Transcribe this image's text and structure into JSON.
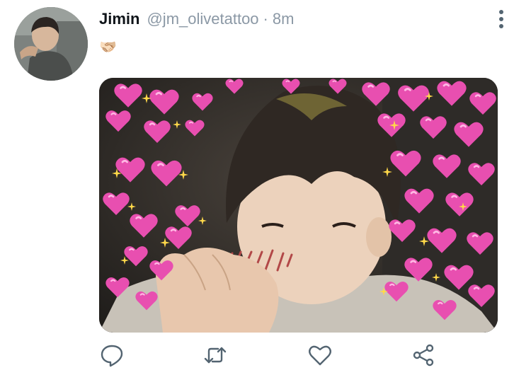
{
  "tweet": {
    "display_name": "Jimin",
    "handle": "@jm_olivetattoo",
    "separator": "·",
    "time": "8m",
    "text": "🫱🏻‍🫲🏼"
  },
  "icons": {
    "more": "more-vertical-icon",
    "reply": "reply-icon",
    "retweet": "retweet-icon",
    "like": "heart-icon",
    "share": "share-icon"
  },
  "colors": {
    "name": "#0f1419",
    "muted": "#8b98a5",
    "icon": "#536471",
    "heart_pink": "#e84fb0"
  }
}
